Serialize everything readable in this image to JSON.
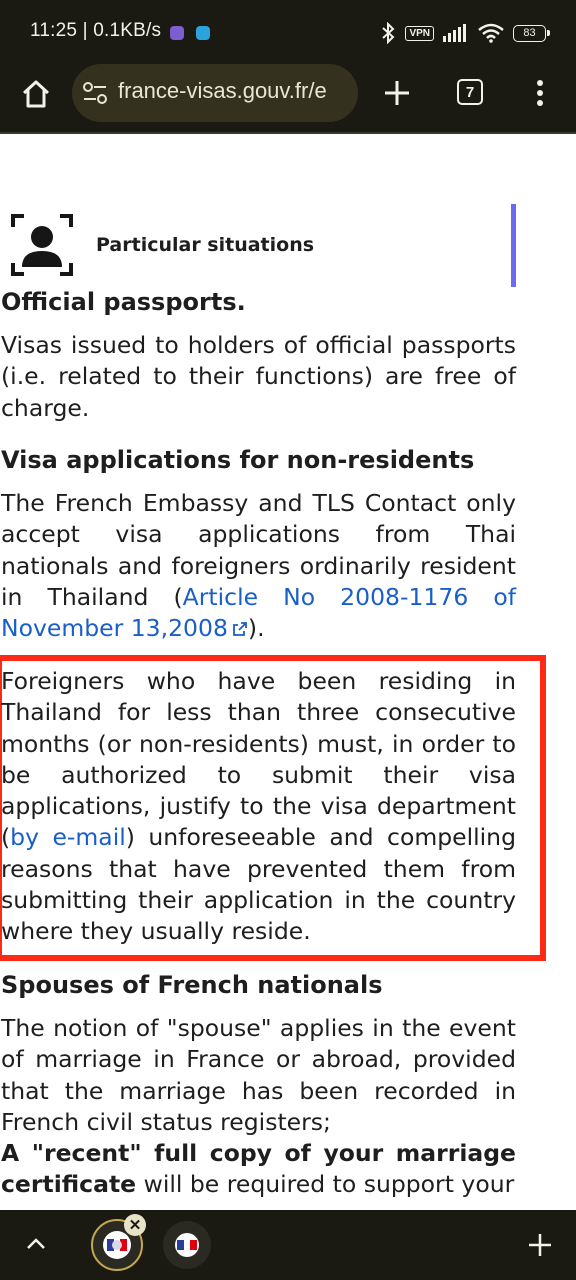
{
  "status_bar": {
    "time_speed": "11:25 | 0.1KB/s",
    "vpn_label": "VPN",
    "battery_level": "83",
    "icons": [
      "viber-icon",
      "telegram-icon",
      "bluetooth-icon",
      "vpn-icon",
      "signal-icon",
      "wifi-icon",
      "battery-icon"
    ]
  },
  "browser": {
    "url": "france-visas.gouv.fr/e",
    "tab_count": "7",
    "icons": [
      "home-icon",
      "site-settings-icon",
      "new-tab-icon",
      "tab-switcher-icon",
      "menu-icon"
    ]
  },
  "page": {
    "section_label": "Particular situations",
    "accent_color": "#6a6af4",
    "link_color": "#1a5fc9",
    "highlight_color": "#ff2a16",
    "official_passports": {
      "heading": "Official passports.",
      "body": "Visas issued to holders of official passports (i.e. related to their functions) are free of charge."
    },
    "non_residents": {
      "heading": "Visa applications for non-residents",
      "body_before": "The French Embassy and TLS Contact only accept visa applications from Thai nationals and foreigners ordinarily resident in Thailand (",
      "link": "Article No 2008-1176 of November 13,2008",
      "body_after": ").",
      "second_before": "Foreigners who have been residing in Thailand for less than three consecutive months (or non-residents) must, in order to be authorized to submit their visa applications, justify to the visa department (",
      "second_link": "by e-mail",
      "second_after": ") unforeseeable and compelling reasons that have prevented them from submitting their application in the country where they usually reside."
    },
    "spouses": {
      "heading": "Spouses of French nationals",
      "body": "The notion of \"spouse\" applies in the event of marriage in France or abroad, provided that the marriage has been recorded in French civil status registers;",
      "bold": "A \"recent\" full copy of your marriage certificate",
      "body_after": " will be required to support your"
    }
  },
  "bottom_bar": {
    "icons": [
      "chevron-up-icon",
      "close-icon",
      "add-tab-icon"
    ],
    "close_label": "✕"
  }
}
